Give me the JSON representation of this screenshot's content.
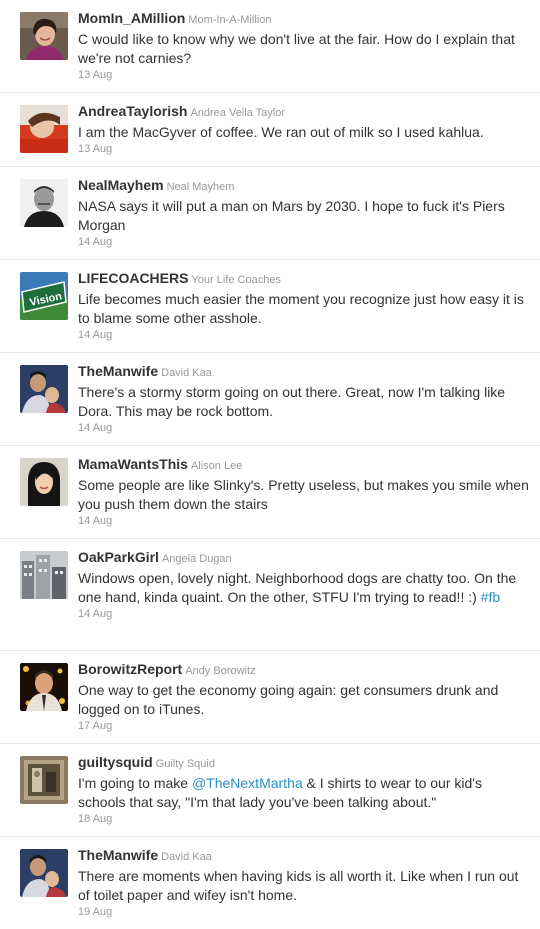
{
  "tweets": [
    {
      "screen_name": "MomIn_AMillion",
      "full_name": "Mom-In-A-Million",
      "parts": [
        "C would like to know why we don't live at the fair. How do I explain that we're not carnies?"
      ],
      "time": "13 Aug",
      "avatar": "avatar-woman-smiling"
    },
    {
      "screen_name": "AndreaTaylorish",
      "full_name": "Andrea Vella Taylor",
      "parts": [
        "I am the MacGyver of coffee. We ran out of milk so I used kahlua."
      ],
      "time": "13 Aug",
      "avatar": "avatar-woman-red-shirt"
    },
    {
      "screen_name": "NealMayhem",
      "full_name": "Neal Mayhem",
      "parts": [
        "NASA says it will put a man on Mars by 2030. I hope to fuck it's Piers Morgan"
      ],
      "time": "14 Aug",
      "avatar": "avatar-man-grayscale"
    },
    {
      "screen_name": "LIFECOACHERS",
      "full_name": "Your Life Coaches",
      "parts": [
        "Life becomes much easier the moment you recognize just how easy it is to blame some other asshole."
      ],
      "time": "14 Aug",
      "avatar": "avatar-vision-sign"
    },
    {
      "screen_name": "TheManwife",
      "full_name": "David Kaa",
      "parts": [
        "There's a stormy storm going on out there. Great, now I'm talking like Dora. This may be rock bottom."
      ],
      "time": "14 Aug",
      "avatar": "avatar-man-kid"
    },
    {
      "screen_name": "MamaWantsThis",
      "full_name": "Alison Lee",
      "parts": [
        "Some people are like Slinky's. Pretty useless, but makes you smile when you push them down the stairs"
      ],
      "time": "14 Aug",
      "avatar": "avatar-woman-dark-hair"
    },
    {
      "screen_name": "OakParkGirl",
      "full_name": "Angela Dugan",
      "parts": [
        "Windows open, lovely night. Neighborhood dogs are chatty too. On the one hand, kinda quaint. On the other, STFU I'm trying to read!! :) "
      ],
      "hashtag": "#fb",
      "time": "14 Aug",
      "avatar": "avatar-city-buildings"
    },
    {
      "screen_name": "BorowitzReport",
      "full_name": "Andy Borowitz",
      "parts": [
        "One way to get the economy going again: get consumers drunk and logged on to iTunes."
      ],
      "time": "17 Aug",
      "avatar": "avatar-man-lights"
    },
    {
      "screen_name": "guiltysquid",
      "full_name": "Guilty Squid",
      "parts": [
        "I'm going to make ",
        " & I shirts to wear to our kid's schools that say, \"I'm that lady you've been talking about.\""
      ],
      "mention": "@TheNextMartha",
      "time": "18 Aug",
      "avatar": "avatar-sepia-photo"
    },
    {
      "screen_name": "TheManwife",
      "full_name": "David Kaa",
      "parts": [
        "There are moments when having kids is all worth it. Like when I run out of toilet paper and wifey isn't home."
      ],
      "time": "19 Aug",
      "avatar": "avatar-man-kid"
    }
  ]
}
